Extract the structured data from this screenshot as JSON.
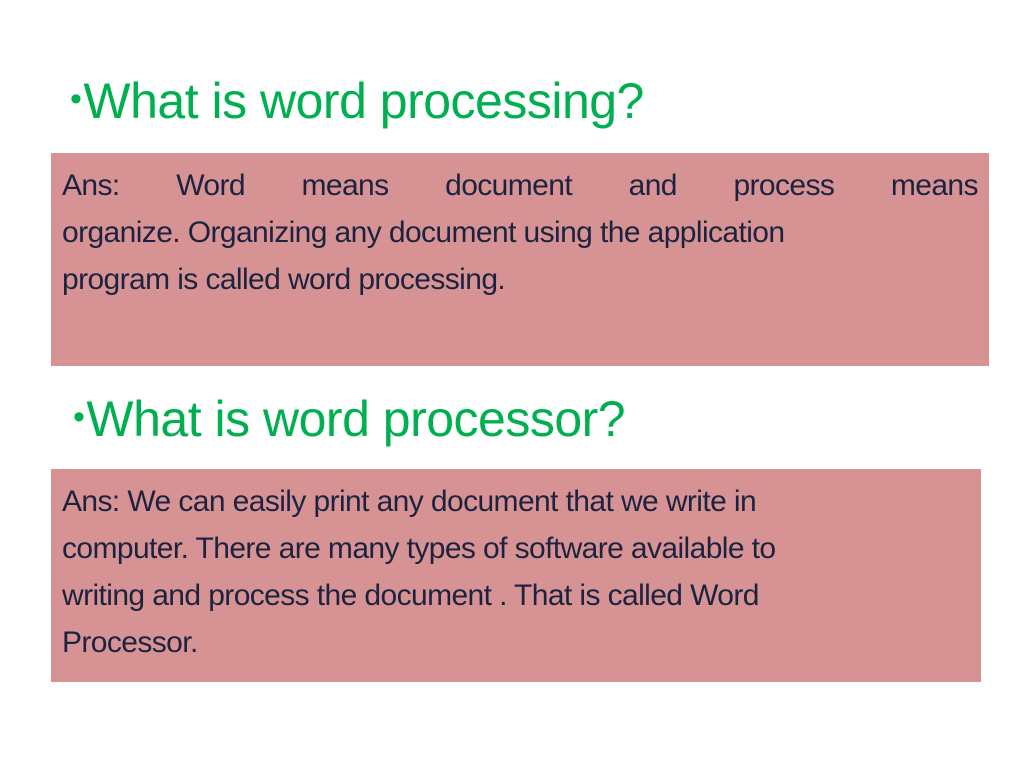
{
  "slide": {
    "colors": {
      "heading": "#00b050",
      "box_background": "#d79393",
      "answer_text": "#1c2340",
      "page_background": "#ffffff"
    },
    "bullet_glyph": "•",
    "questions": [
      {
        "question": "What is word processing?",
        "answer_lines": [
          [
            "Ans:",
            "Word",
            "means",
            "document",
            "and",
            "process",
            "means"
          ],
          "organize. Organizing any document using the application",
          "program is called word processing."
        ]
      },
      {
        "question": "What is word processor?",
        "answer_lines": [
          "Ans: We can easily print any document that we write in",
          "computer. There are many types of software available to",
          "writing and process the document . That is called Word",
          "Processor."
        ]
      }
    ]
  }
}
